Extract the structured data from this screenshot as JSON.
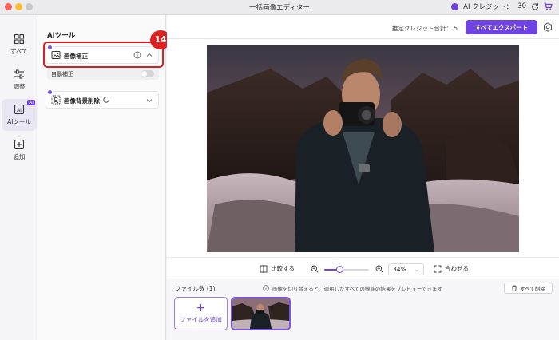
{
  "window": {
    "title": "一括画像エディター"
  },
  "credits": {
    "label": "AI クレジット：",
    "value": "30"
  },
  "rail": {
    "items": [
      {
        "label": "すべて",
        "icon": "grid-icon"
      },
      {
        "label": "調整",
        "icon": "sliders-icon"
      },
      {
        "label": "AIツール",
        "icon": "ai-icon",
        "badge": "AI"
      },
      {
        "label": "追加",
        "icon": "plus-square-icon"
      }
    ]
  },
  "panel": {
    "title": "AIツール",
    "tools": [
      {
        "label": "画像補正",
        "icon": "image-enhance-icon",
        "expanded": true
      },
      {
        "label": "画像背景削除",
        "icon": "background-remove-icon",
        "expanded": false
      }
    ],
    "auto_label": "自動補正",
    "step_number": "14"
  },
  "topbar": {
    "estimate_label": "推定クレジット合計：",
    "estimate_value": "5",
    "export_label": "すべてエクスポート"
  },
  "zoombar": {
    "compare_label": "比較する",
    "zoom_value": "34%",
    "zoom_fraction": 0.34,
    "fit_label": "合わせる"
  },
  "files": {
    "title": "ファイル数 (1)",
    "info": "画像を切り替えると、適用したすべての機能の結果をプレビューできます",
    "delete_all_label": "すべて削除",
    "add_label": "ファイルを追加"
  },
  "colors": {
    "accent": "#6e42e3",
    "highlight": "#e02020"
  }
}
